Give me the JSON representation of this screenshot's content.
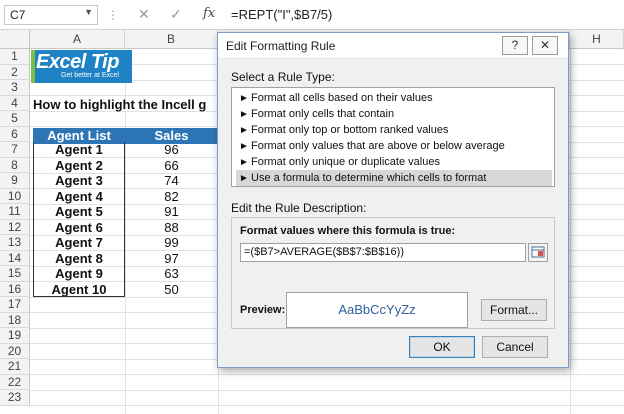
{
  "formula_bar": {
    "name_box": "C7",
    "cancel_icon": "✕",
    "enter_icon": "✓",
    "fx_label": "fx",
    "formula": "=REPT(\"I\",$B7/5)"
  },
  "sheet": {
    "columns": [
      "A",
      "B",
      "H"
    ],
    "rows": [
      "1",
      "2",
      "3",
      "4",
      "5",
      "6",
      "7",
      "8",
      "9",
      "10",
      "11",
      "12",
      "13",
      "14",
      "15",
      "16",
      "17",
      "18",
      "19",
      "20",
      "21",
      "22",
      "23"
    ],
    "logo": {
      "brand": "Excel Tip",
      "brand_part1": "Excel",
      "brand_part2": "Tip",
      "tagline": "Get better at Excel"
    },
    "headline": "How to highlight the Incell g",
    "table": {
      "headers": [
        "Agent List",
        "Sales"
      ],
      "rows": [
        [
          "Agent 1",
          "96"
        ],
        [
          "Agent 2",
          "66"
        ],
        [
          "Agent 3",
          "74"
        ],
        [
          "Agent 4",
          "82"
        ],
        [
          "Agent 5",
          "91"
        ],
        [
          "Agent 6",
          "88"
        ],
        [
          "Agent 7",
          "99"
        ],
        [
          "Agent 8",
          "97"
        ],
        [
          "Agent 9",
          "63"
        ],
        [
          "Agent 10",
          "50"
        ]
      ]
    },
    "colors": {
      "header_fill": "#2e75b6",
      "logo_fill": "#1f82c4"
    }
  },
  "dialog": {
    "title": "Edit Formatting Rule",
    "help_button": "?",
    "close_button": "✕",
    "select_rule_type_label": "Select a Rule Type:",
    "rule_types": [
      "Format all cells based on their values",
      "Format only cells that contain",
      "Format only top or bottom ranked values",
      "Format only values that are above or below average",
      "Format only unique or duplicate values",
      "Use a formula to determine which cells to format"
    ],
    "selected_rule_index": 5,
    "edit_description_label": "Edit the Rule Description:",
    "formula_label": "Format values where this formula is true:",
    "formula_value": "=($B7>AVERAGE($B$7:$B$16))",
    "preview_label": "Preview:",
    "preview_text": "AaBbCcYyZz",
    "format_button": "Format...",
    "ok_button": "OK",
    "cancel_button": "Cancel"
  }
}
